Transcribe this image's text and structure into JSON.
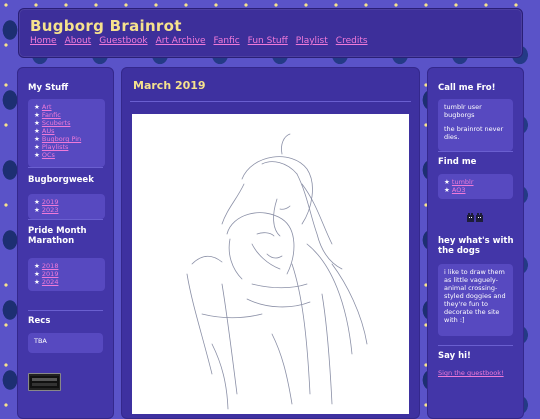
{
  "site": {
    "title": "Bugborg Brainrot",
    "nav": [
      "Home",
      "About",
      "Guestbook",
      "Art Archive",
      "Fanfic",
      "Fun Stuff",
      "Playlist",
      "Credits"
    ]
  },
  "left": {
    "my_stuff_title": "My Stuff",
    "my_stuff": [
      "Art",
      "Fanfic",
      "Scuberts",
      "AUs",
      "Bugborg Pin",
      "Playlists",
      "OCs"
    ],
    "bugborgweek_title": "Bugborgweek",
    "bugborgweek": [
      "2019",
      "2023"
    ],
    "pride_title": "Pride Month Marathon",
    "pride": [
      "2018",
      "2019",
      "2024"
    ],
    "recs_title": "Recs",
    "recs_text": "TBA"
  },
  "main": {
    "post_title": "March 2019"
  },
  "right": {
    "call_me_title": "Call me Fro!",
    "call_me_line1": "tumblr user bugborgs",
    "call_me_line2": "the brainrot never dies.",
    "find_me_title": "Find me",
    "find_me": [
      "tumblr",
      "AO3"
    ],
    "dogs_title": "hey what's with the dogs",
    "dogs_text": "i like to draw them as little vaguely-animal crossing-styled doggies and they're fun to decorate the site with :]",
    "say_hi_title": "Say hi!",
    "say_hi_link": "Sign the guestbook!"
  },
  "colors": {
    "background": "#5a53c8",
    "panel": "#4336a8",
    "title_yellow": "#f6e28d",
    "link_pink": "#f07ad9"
  }
}
